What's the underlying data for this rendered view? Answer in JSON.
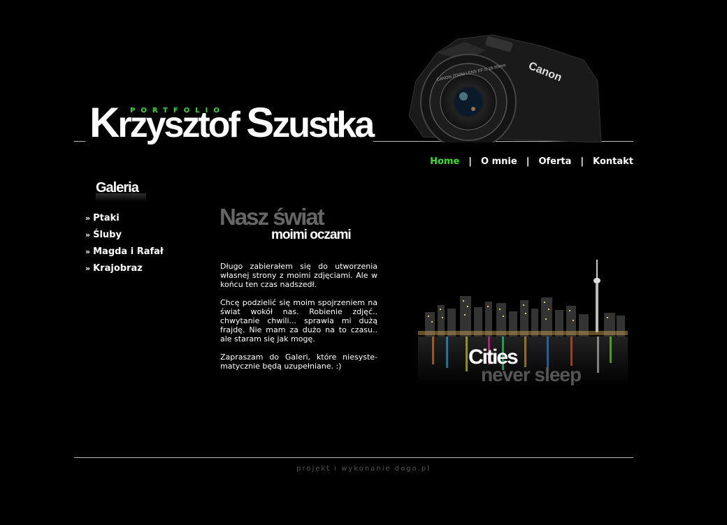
{
  "header": {
    "portfolio": "PORTFOLIO",
    "name_first_cap": "K",
    "name_first_rest": "rzysztof ",
    "name_last_cap": "S",
    "name_last_rest": "zustka"
  },
  "nav": {
    "items": [
      {
        "label": "Home",
        "active": true
      },
      {
        "label": "O mnie"
      },
      {
        "label": "Oferta"
      },
      {
        "label": "Kontakt"
      }
    ],
    "separator": "|"
  },
  "gallery": {
    "title": "Galeria",
    "arrow": "»",
    "items": [
      "Ptaki",
      "Śluby",
      "Magda i Rafał",
      "Krajobraz"
    ]
  },
  "main": {
    "headline1": "Nasz świat",
    "headline2": "moimi oczami",
    "paragraphs": [
      "Długo zabierałem się do utworzenia własnej strony z moimi zdjęciami. Ale w końcu ten czas nadszedł.",
      "Chcę podzielić się moim spojrzeniem na świat wokół nas. Robienie zdjęć.. chwytanie chwili... sprawia mi dużą frajdę. Nie mam za dużo na to czasu.. ale staram się jak mogę.",
      "Zapraszam do Galeri, które niesyste-matycznie będą uzupełniane. :)"
    ]
  },
  "promo": {
    "line1": "Cities",
    "line2": "never sleep"
  },
  "camera": {
    "brand": "Canon",
    "lens": "CANON ZOOM LENS EF-S 18-55mm"
  },
  "footer": {
    "text": "projekt i wykonanie dogo.pl"
  },
  "colors": {
    "accent": "#3ddc34",
    "background": "#000000"
  }
}
